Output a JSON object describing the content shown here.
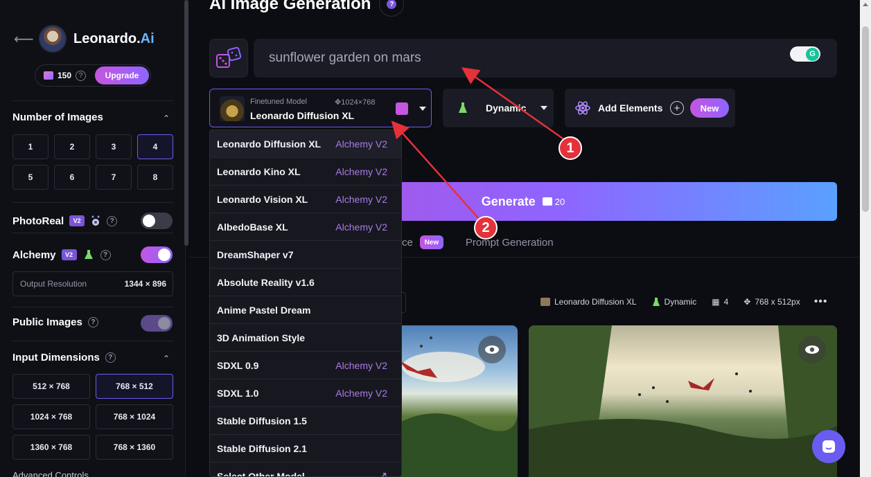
{
  "page": {
    "title": "AI Image Generation"
  },
  "sidebar": {
    "brand": "Leonardo.",
    "brand_suffix": "Ai",
    "credits": "150",
    "upgrade_label": "Upgrade",
    "num_images_title": "Number of Images",
    "num_images": [
      "1",
      "2",
      "3",
      "4",
      "5",
      "6",
      "7",
      "8"
    ],
    "num_images_selected": "4",
    "photoreal_label": "PhotoReal",
    "photoreal_badge": "V2",
    "alchemy_label": "Alchemy",
    "alchemy_badge": "V2",
    "output_res_label": "Output Resolution",
    "output_res_value": "1344 × 896",
    "public_images_label": "Public Images",
    "input_dims_title": "Input Dimensions",
    "dimensions": [
      "512 × 768",
      "768 × 512",
      "1024 × 768",
      "768 × 1024",
      "1360 × 768",
      "768 × 1360"
    ],
    "dimension_selected": "768 × 512",
    "advanced_label": "Advanced Controls"
  },
  "prompt": {
    "value": "sunflower garden on mars"
  },
  "model": {
    "kicker": "Finetuned Model",
    "size": "1024×768",
    "name": "Leonardo Diffusion XL"
  },
  "style": {
    "label": "Dynamic"
  },
  "elements": {
    "label": "Add Elements",
    "new_badge": "New"
  },
  "generate": {
    "label": "Generate",
    "cost": "20"
  },
  "tabs": {
    "partial_label": "ce",
    "new_badge": "New",
    "prompt_generation": "Prompt Generation"
  },
  "meta": {
    "model": "Leonardo Diffusion XL",
    "style": "Dynamic",
    "count": "4",
    "size": "768 x 512px"
  },
  "dropdown": {
    "items": [
      {
        "name": "Leonardo Diffusion XL",
        "tag": "Alchemy V2"
      },
      {
        "name": "Leonardo Kino XL",
        "tag": "Alchemy V2"
      },
      {
        "name": "Leonardo Vision XL",
        "tag": "Alchemy V2"
      },
      {
        "name": "AlbedoBase XL",
        "tag": "Alchemy V2"
      },
      {
        "name": "DreamShaper v7",
        "tag": ""
      },
      {
        "name": "Absolute Reality v1.6",
        "tag": ""
      },
      {
        "name": "Anime Pastel Dream",
        "tag": ""
      },
      {
        "name": "3D Animation Style",
        "tag": ""
      },
      {
        "name": "SDXL 0.9",
        "tag": "Alchemy V2"
      },
      {
        "name": "SDXL 1.0",
        "tag": "Alchemy V2"
      },
      {
        "name": "Stable Diffusion 1.5",
        "tag": ""
      },
      {
        "name": "Stable Diffusion 2.1",
        "tag": ""
      },
      {
        "name": "Select Other Model",
        "tag": ""
      }
    ]
  },
  "callouts": [
    "1",
    "2"
  ],
  "colors": {
    "accent": "#8f64ff",
    "pink": "#c456e0",
    "callout": "#e4313a"
  }
}
